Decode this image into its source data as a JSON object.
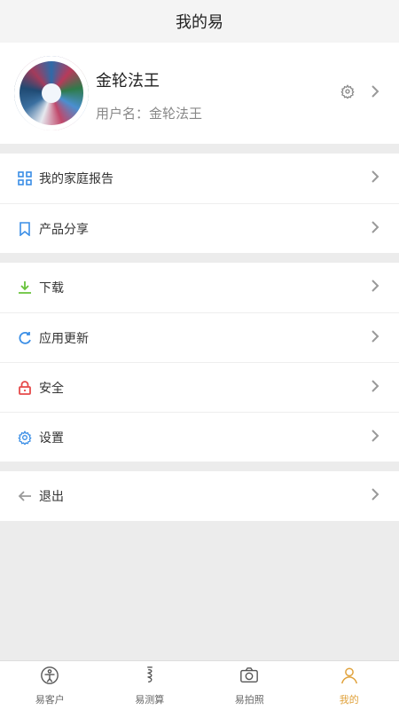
{
  "header": {
    "title": "我的易"
  },
  "profile": {
    "name": "金轮法王",
    "username_label": "用户名：金轮法王"
  },
  "menu_groups": [
    [
      {
        "label": "我的家庭报告",
        "icon": "grid-icon",
        "color": "#3a8ee6"
      },
      {
        "label": "产品分享",
        "icon": "bookmark-icon",
        "color": "#3a8ee6"
      }
    ],
    [
      {
        "label": "下载",
        "icon": "download-icon",
        "color": "#67c23a"
      },
      {
        "label": "应用更新",
        "icon": "refresh-icon",
        "color": "#3a8ee6"
      },
      {
        "label": "安全",
        "icon": "lock-icon",
        "color": "#e64a4a"
      },
      {
        "label": "设置",
        "icon": "gear-icon",
        "color": "#3a8ee6"
      }
    ],
    [
      {
        "label": "退出",
        "icon": "arrow-left-icon",
        "color": "#999999"
      }
    ]
  ],
  "tabbar": {
    "items": [
      {
        "label": "易客户",
        "icon": "customer-icon"
      },
      {
        "label": "易测算",
        "icon": "calc-icon"
      },
      {
        "label": "易拍照",
        "icon": "camera-icon"
      },
      {
        "label": "我的",
        "icon": "user-icon",
        "active": true
      }
    ],
    "active_color": "#e0a13a"
  }
}
